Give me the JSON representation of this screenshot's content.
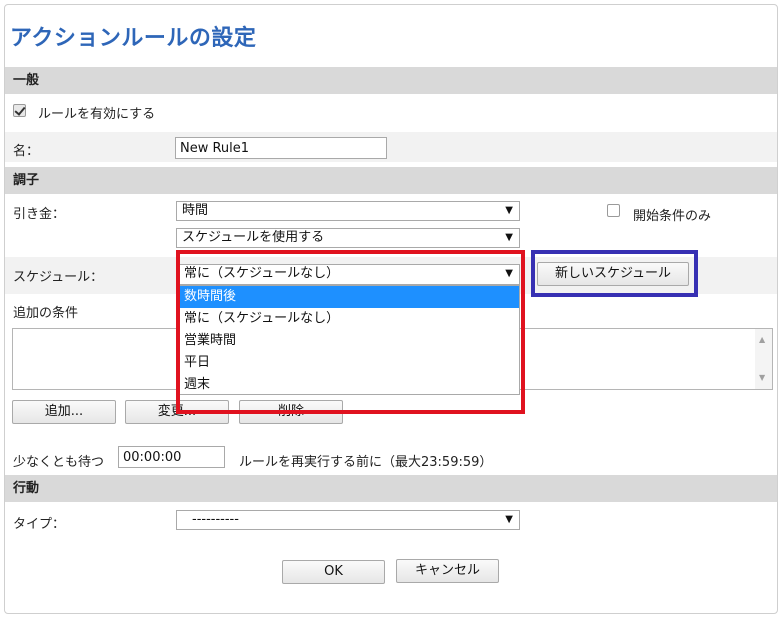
{
  "title": "アクションルールの設定",
  "general": {
    "header": "一般",
    "enable_label": "ルールを有効にする",
    "enabled": true,
    "name_label": "名：",
    "name_value": "New Rule1"
  },
  "condition": {
    "header": "調子",
    "trigger_label": "引き金：",
    "trigger_value": "時間",
    "trigger_sub_value": "スケジュールを使用する",
    "start_only_label": "開始条件のみ",
    "start_only_checked": false,
    "schedule_label": "スケジュール：",
    "schedule_value": "常に（スケジュールなし）",
    "schedule_options": [
      "数時間後",
      "常に（スケジュールなし）",
      "営業時間",
      "平日",
      "週末"
    ],
    "highlighted_option": "数時間後",
    "new_schedule_button": "新しいスケジュール",
    "additional_label": "追加の条件",
    "add_button": "追加...",
    "change_button": "変更...",
    "delete_button": "削除",
    "wait_label": "少なくとも待つ",
    "wait_value": "00:00:00",
    "wait_suffix": "ルールを再実行する前に（最大23:59:59）"
  },
  "action": {
    "header": "行動",
    "type_label": "タイプ：",
    "type_value": "----------"
  },
  "footer": {
    "ok_button": "OK",
    "cancel_button": "キャンセル"
  },
  "colors": {
    "title": "#2e66b8",
    "highlight": "#1e90ff",
    "red_annotation": "#e0121f",
    "blue_annotation": "#3730b3"
  }
}
